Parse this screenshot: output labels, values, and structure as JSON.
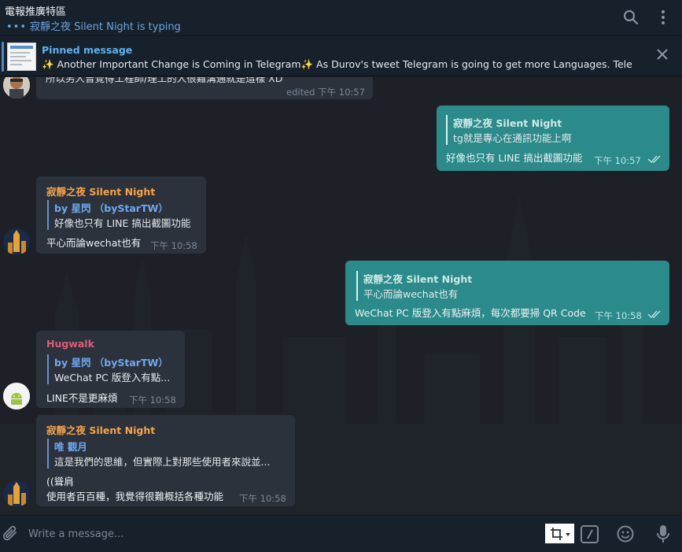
{
  "header": {
    "title": "電報推廣特區",
    "typing_dots": "•••",
    "typing": "寂靜之夜 Silent Night is typing",
    "icons": [
      "search-icon",
      "more-vertical-icon"
    ]
  },
  "pinned": {
    "label": "Pinned message",
    "text": "✨ Another Important Change is Coming in Telegram✨  As Durov's tweet Telegram is going to get more Languages. Telegram"
  },
  "messages": [
    {
      "id": "m0",
      "direction": "in",
      "text": "所以另人曾覺得工程師/理工的人很難溝通就是這樣 XD",
      "time": "edited 下午 10:57"
    },
    {
      "id": "m1",
      "direction": "out",
      "quote_author": "寂靜之夜 Silent Night",
      "quote_text": "tg就是專心在通訊功能上啊",
      "text": "好像也只有 LINE 搞出截圖功能",
      "time": "下午 10:57"
    },
    {
      "id": "m2",
      "direction": "in",
      "sender": "寂靜之夜 Silent Night",
      "quote_author": "by 星閃 （byStarTW）",
      "quote_text": "好像也只有 LINE 搞出截圖功能",
      "text": "平心而論wechat也有",
      "time": "下午 10:58"
    },
    {
      "id": "m3",
      "direction": "out",
      "quote_author": "寂靜之夜 Silent Night",
      "quote_text": "平心而論wechat也有",
      "text": "WeChat PC 版登入有點麻煩，每次都要掃 QR Code",
      "time": "下午 10:58"
    },
    {
      "id": "m4",
      "direction": "in",
      "sender": "Hugwalk",
      "quote_author": "by 星閃 （byStarTW）",
      "quote_text": "WeChat PC 版登入有點...",
      "text": "LINE不是更麻煩",
      "time": "下午 10:58"
    },
    {
      "id": "m5",
      "direction": "in",
      "sender": "寂靜之夜 Silent Night",
      "quote_author": "唯 觀月",
      "quote_text": "這是我們的思維，但實際上對那些使用者來說並...",
      "text_line1": "((聳肩",
      "text_line2": "使用者百百種，我覺得很難概括各種功能",
      "time": "下午 10:58"
    }
  ],
  "composer": {
    "placeholder": "Write a message...",
    "icons": [
      "attach-icon",
      "crop-icon",
      "commands-icon",
      "emoji-icon",
      "microphone-icon"
    ]
  },
  "colors": {
    "accent": "#5eb1f0",
    "outgoing_bubble": "#2b8a8a",
    "incoming_bubble": "#2b323c",
    "sender_orange": "#f5a34a",
    "sender_red": "#e05a7a"
  }
}
